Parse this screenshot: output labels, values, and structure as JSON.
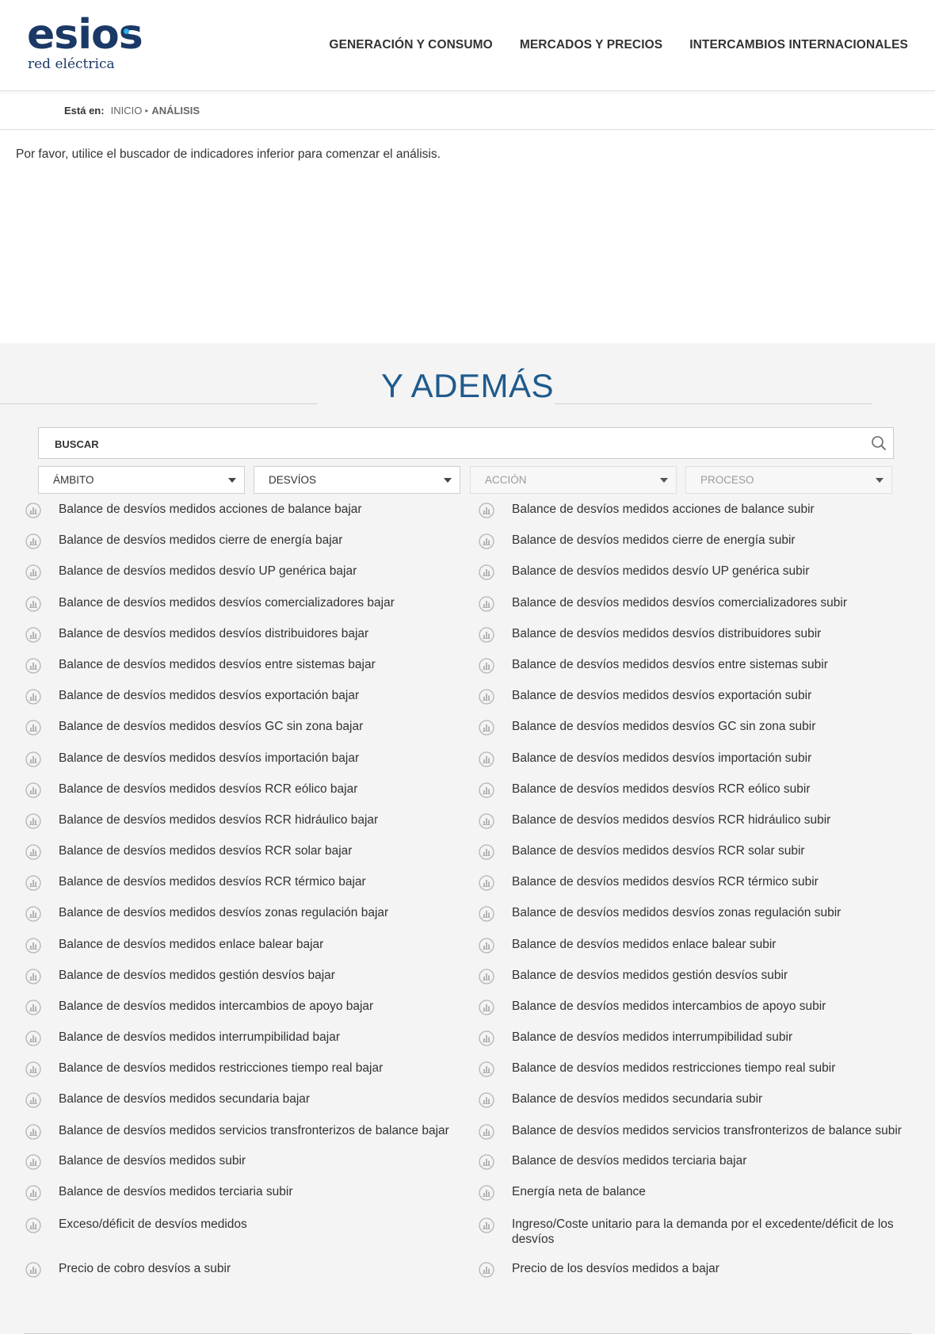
{
  "logo": {
    "main": "esios",
    "sub": "red eléctrica"
  },
  "nav": {
    "items": [
      "GENERACIÓN Y CONSUMO",
      "MERCADOS Y PRECIOS",
      "INTERCAMBIOS INTERNACIONALES"
    ]
  },
  "breadcrumb": {
    "label": "Está en:",
    "home": "INICIO",
    "separator": "▸",
    "current": "ANÁLISIS"
  },
  "intro": "Por favor, utilice el buscador de indicadores inferior para comenzar el análisis.",
  "more": {
    "title": "Y ADEMÁS",
    "search_placeholder": "BUSCAR",
    "filters": [
      {
        "label": "ÁMBITO",
        "enabled": true
      },
      {
        "label": "DESVÍOS",
        "enabled": true
      },
      {
        "label": "ACCIÓN",
        "enabled": false
      },
      {
        "label": "PROCESO",
        "enabled": false
      }
    ]
  },
  "indicators": {
    "left": [
      "Balance de desvíos medidos acciones de balance bajar",
      "Balance de desvíos medidos cierre de energía bajar",
      "Balance de desvíos medidos desvío UP genérica bajar",
      "Balance de desvíos medidos desvíos comercializadores bajar",
      "Balance de desvíos medidos desvíos distribuidores bajar",
      "Balance de desvíos medidos desvíos entre sistemas bajar",
      "Balance de desvíos medidos desvíos exportación bajar",
      "Balance de desvíos medidos desvíos GC sin zona bajar",
      "Balance de desvíos medidos desvíos importación bajar",
      "Balance de desvíos medidos desvíos RCR eólico bajar",
      "Balance de desvíos medidos desvíos RCR hidráulico bajar",
      "Balance de desvíos medidos desvíos RCR solar bajar",
      "Balance de desvíos medidos desvíos RCR térmico bajar",
      "Balance de desvíos medidos desvíos zonas regulación bajar",
      "Balance de desvíos medidos enlace balear bajar",
      "Balance de desvíos medidos gestión desvíos bajar",
      "Balance de desvíos medidos intercambios de apoyo bajar",
      "Balance de desvíos medidos interrumpibilidad bajar",
      "Balance de desvíos medidos restricciones tiempo real bajar",
      "Balance de desvíos medidos secundaria bajar",
      "Balance de desvíos medidos servicios transfronterizos de balance bajar",
      "Balance de desvíos medidos subir",
      "Balance de desvíos medidos terciaria subir",
      "Exceso/déficit de desvíos medidos",
      "Precio de cobro desvíos a subir"
    ],
    "right": [
      "Balance de desvíos medidos acciones de balance subir",
      "Balance de desvíos medidos cierre de energía subir",
      "Balance de desvíos medidos desvío UP genérica subir",
      "Balance de desvíos medidos desvíos comercializadores subir",
      "Balance de desvíos medidos desvíos distribuidores subir",
      "Balance de desvíos medidos desvíos entre sistemas subir",
      "Balance de desvíos medidos desvíos exportación subir",
      "Balance de desvíos medidos desvíos GC sin zona subir",
      "Balance de desvíos medidos desvíos importación subir",
      "Balance de desvíos medidos desvíos RCR eólico subir",
      "Balance de desvíos medidos desvíos RCR hidráulico subir",
      "Balance de desvíos medidos desvíos RCR solar subir",
      "Balance de desvíos medidos desvíos RCR térmico subir",
      "Balance de desvíos medidos desvíos zonas regulación subir",
      "Balance de desvíos medidos enlace balear subir",
      "Balance de desvíos medidos gestión desvíos subir",
      "Balance de desvíos medidos intercambios de apoyo subir",
      "Balance de desvíos medidos interrumpibilidad subir",
      "Balance de desvíos medidos restricciones tiempo real subir",
      "Balance de desvíos medidos secundaria subir",
      "Balance de desvíos medidos servicios transfronterizos de balance subir",
      "Balance de desvíos medidos terciaria bajar",
      "Energía neta de balance",
      "Ingreso/Coste unitario para la demanda por el excedente/déficit de los desvíos",
      "Precio de los desvíos medidos a bajar"
    ],
    "icon": "chart-circle-icon"
  }
}
